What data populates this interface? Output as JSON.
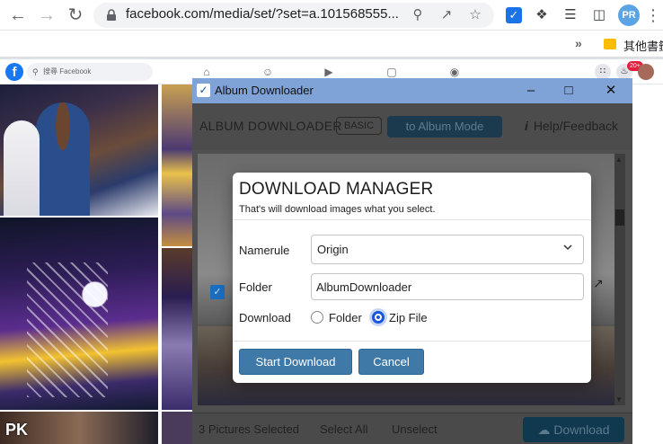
{
  "browser": {
    "url": "facebook.com/media/set/?set=a.101568555...",
    "profile_initials": "PR",
    "bookmark_label": "其他書籤"
  },
  "facebook": {
    "logo": "f",
    "search_placeholder": "搜尋 Facebook",
    "notification_badge": "20+",
    "watermark": "PK"
  },
  "album_downloader": {
    "window_title": "Album Downloader",
    "header_title": "ALBUM DOWNLOADER",
    "basic_badge": "BASIC",
    "mode_button": "to Album Mode",
    "help_label": "Help/Feedback",
    "selected_count": "3 Pictures Selected",
    "select_all": "Select All",
    "unselect": "Unselect",
    "download_button": "Download"
  },
  "modal": {
    "title": "DOWNLOAD MANAGER",
    "subtitle": "That's will download images what you select.",
    "namerule_label": "Namerule",
    "namerule_value": "Origin",
    "folder_label": "Folder",
    "folder_value": "AlbumDownloader",
    "download_label": "Download",
    "option_folder": "Folder",
    "option_zip": "Zip File",
    "selected_option": "Zip File",
    "start_button": "Start Download",
    "cancel_button": "Cancel"
  },
  "colors": {
    "titlebar": "#7fa3d7",
    "primary_button": "#3f79a8",
    "radio_selected": "#1a56db",
    "facebook_blue": "#1877f2"
  }
}
